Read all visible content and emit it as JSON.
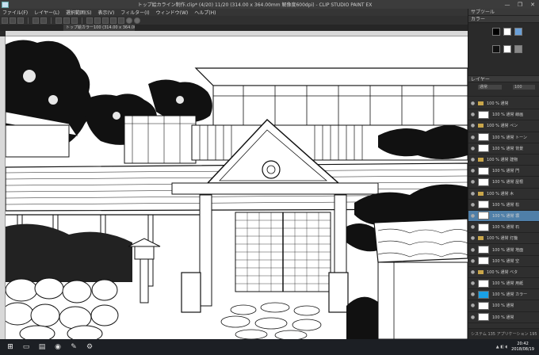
{
  "window": {
    "title": "トップ絵カライン制作.clip* (4/20) 11/20 (314.00 x 364.00mm 解像度600dpi) - CLIP STUDIO PAINT EX",
    "buttons": [
      "—",
      "❐",
      "✕"
    ]
  },
  "menu": [
    "ファイル(F)",
    "レイヤー(L)",
    "選択範囲(S)",
    "表示(V)",
    "フィルター(I)",
    "ウィンドウ(W)",
    "ヘルプ(H)"
  ],
  "canvas_tab": {
    "label": "トップ絵カラー100 (314.00 x 364.00)"
  },
  "panels": {
    "top_title": "サブツール",
    "color_title": "カラー",
    "layer_title": "レイヤー",
    "blend_mode": "通常",
    "opacity": "100",
    "layers": [
      {
        "name": "100 % 通常",
        "type": "folder",
        "selected": false
      },
      {
        "name": "100 % 通常 線画",
        "type": "layer",
        "selected": false
      },
      {
        "name": "100 % 通常 ペン",
        "type": "folder",
        "selected": false
      },
      {
        "name": "100 % 通常 トーン",
        "type": "layer",
        "selected": false
      },
      {
        "name": "100 % 通常 背景",
        "type": "layer",
        "selected": false
      },
      {
        "name": "100 % 通常 建物",
        "type": "folder",
        "selected": false
      },
      {
        "name": "100 % 通常 門",
        "type": "layer",
        "selected": false
      },
      {
        "name": "100 % 通常 屋根",
        "type": "layer",
        "selected": false
      },
      {
        "name": "100 % 通常 木",
        "type": "folder",
        "selected": false
      },
      {
        "name": "100 % 通常 松",
        "type": "layer",
        "selected": false
      },
      {
        "name": "100 % 通常 塀",
        "type": "layer",
        "selected": true
      },
      {
        "name": "100 % 通常 石",
        "type": "layer",
        "selected": false
      },
      {
        "name": "100 % 通常 灯籠",
        "type": "folder",
        "selected": false
      },
      {
        "name": "100 % 通常 地面",
        "type": "layer",
        "selected": false
      },
      {
        "name": "100 % 通常 空",
        "type": "layer",
        "selected": false
      },
      {
        "name": "100 % 通常 ベタ",
        "type": "folder",
        "selected": false
      },
      {
        "name": "100 % 通常 用紙",
        "type": "layer",
        "selected": false
      },
      {
        "name": "100 % 通常 カラー",
        "type": "blue",
        "selected": false
      },
      {
        "name": "100 % 通常",
        "type": "layer",
        "selected": false
      },
      {
        "name": "100 % 通常",
        "type": "layer",
        "selected": false
      }
    ],
    "status": "システム 135 アプリケーション 195"
  },
  "taskbar": {
    "clock_time": "20:42",
    "clock_date": "2018/08/19"
  },
  "colors": {
    "selected_layer": "#4f7fa8",
    "accent_blue": "#19a0e6"
  }
}
